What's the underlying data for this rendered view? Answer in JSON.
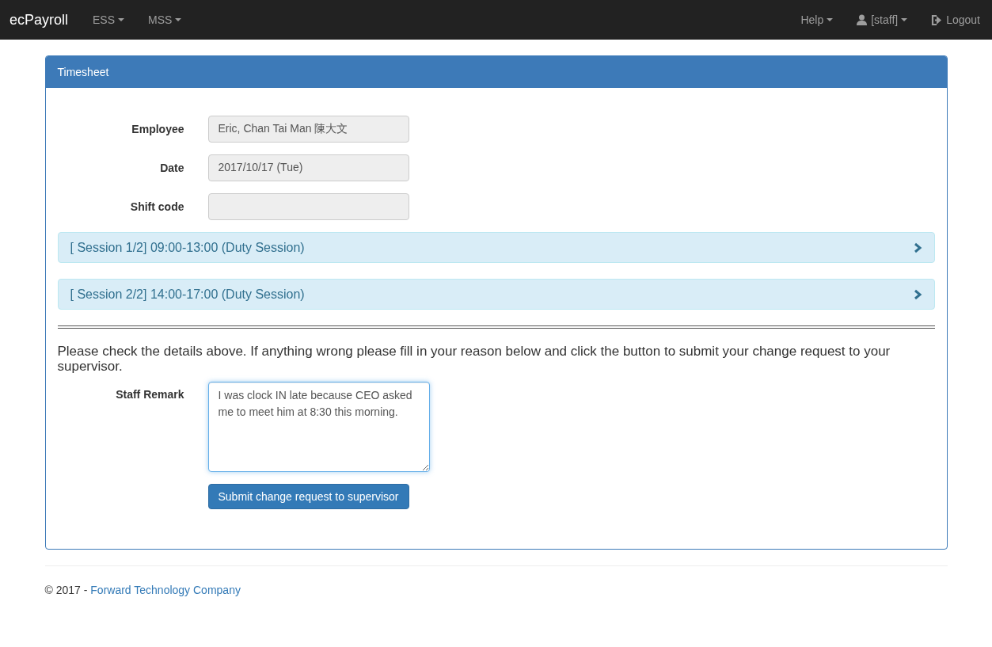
{
  "navbar": {
    "brand": "ecPayroll",
    "left_menu": [
      {
        "label": "ESS",
        "dropdown": true
      },
      {
        "label": "MSS",
        "dropdown": true
      }
    ],
    "right_menu": [
      {
        "kind": "plain",
        "label": "Help",
        "dropdown": true
      },
      {
        "kind": "user",
        "label": "[staff]",
        "dropdown": true
      },
      {
        "kind": "logout",
        "label": "Logout",
        "dropdown": false
      }
    ]
  },
  "panel": {
    "title": "Timesheet",
    "fields": [
      {
        "label": "Employee",
        "value": "Eric, Chan Tai Man 陳大文"
      },
      {
        "label": "Date",
        "value": "2017/10/17 (Tue)"
      },
      {
        "label": "Shift code"
      }
    ],
    "sessions": [
      {
        "title": "[ Session 1/2] 09:00-13:00 (Duty Session)",
        "expanded": false
      },
      {
        "title": "[ Session 2/2] 14:00-17:00 (Duty Session)",
        "expanded": false
      }
    ],
    "instruction": "Please check the details above. If anything wrong please fill in your reason below and click the button to submit your change request to your supervisor.",
    "remark": {
      "label": "Staff Remark",
      "value": "I was clock IN late because CEO asked me to meet him at 8:30 this morning.",
      "focused": true
    },
    "submit_button": "Submit change request to supervisor"
  },
  "footer": {
    "copyright": "© 2017 - ",
    "link": "Forward Technology Company"
  }
}
